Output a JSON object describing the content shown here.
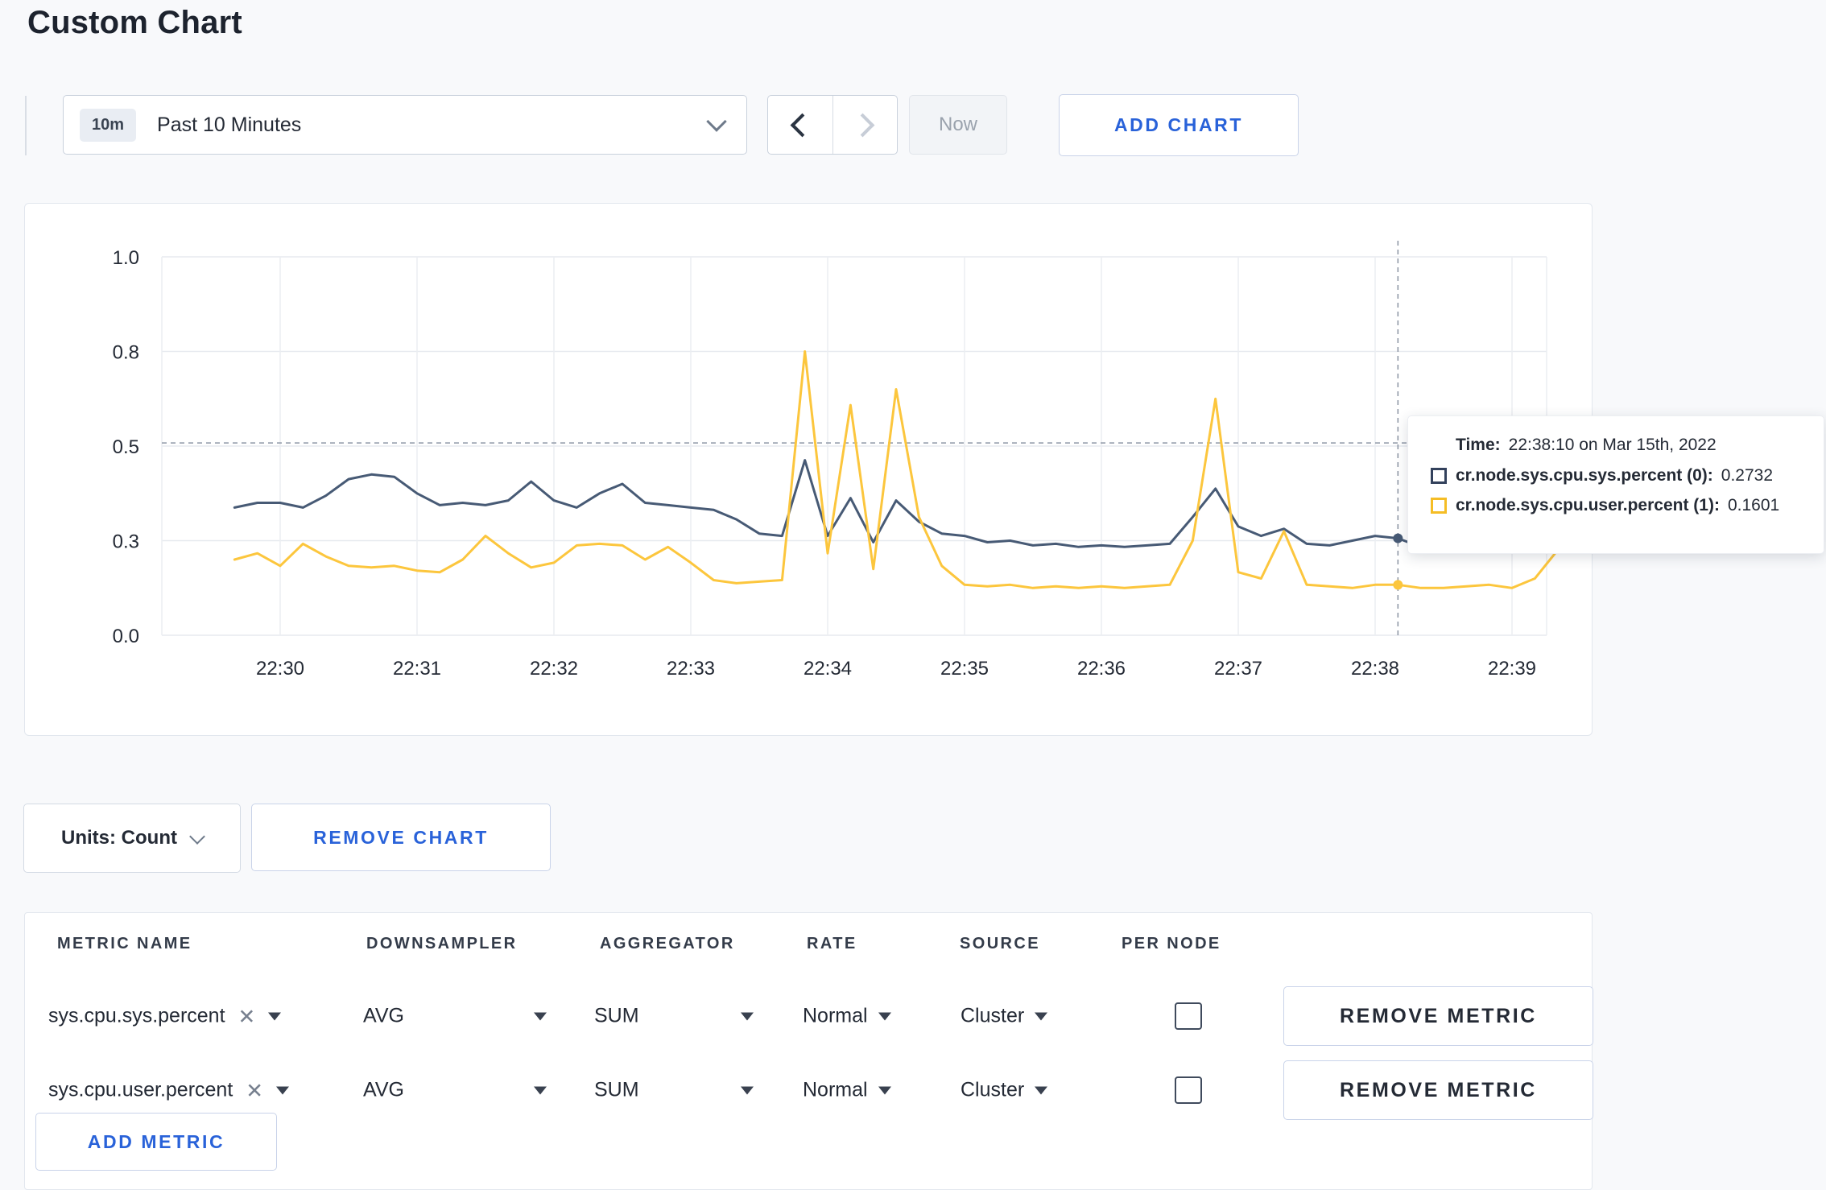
{
  "page": {
    "title": "Custom Chart"
  },
  "toolbar": {
    "time_badge": "10m",
    "time_label": "Past 10 Minutes",
    "now_label": "Now",
    "add_chart_label": "ADD CHART"
  },
  "chart_data": {
    "type": "line",
    "title": "",
    "xlabel": "",
    "ylabel": "",
    "x_ticks": [
      "22:30",
      "22:31",
      "22:32",
      "22:33",
      "22:34",
      "22:35",
      "22:36",
      "22:37",
      "22:38",
      "22:39"
    ],
    "y_ticks": [
      "1.0",
      "0.8",
      "0.5",
      "0.3",
      "0.0"
    ],
    "grid": true,
    "legend_position": "tooltip",
    "x_start_minutes": -0.3333,
    "x_step_minutes": 0.16667,
    "series": [
      {
        "name": "cr.node.sys.cpu.sys.percent",
        "color": "#475a75",
        "values": [
          0.37,
          0.38,
          0.38,
          0.37,
          0.395,
          0.43,
          0.44,
          0.435,
          0.4,
          0.375,
          0.38,
          0.375,
          0.385,
          0.425,
          0.385,
          0.37,
          0.4,
          0.42,
          0.38,
          0.375,
          0.37,
          0.365,
          0.345,
          0.315,
          0.31,
          0.47,
          0.31,
          0.39,
          0.295,
          0.385,
          0.34,
          0.315,
          0.31,
          0.295,
          0.3,
          0.285,
          0.29,
          0.28,
          0.285,
          0.28,
          0.285,
          0.29,
          0.35,
          0.41,
          0.33,
          0.31,
          0.325,
          0.29,
          0.285,
          0.3,
          0.31,
          0.305,
          0.28,
          0.27,
          0.29,
          0.3,
          0.3,
          0.295,
          0.3
        ]
      },
      {
        "name": "cr.node.sys.cpu.user.percent",
        "color": "#fcc63d",
        "values": [
          0.24,
          0.26,
          0.22,
          0.29,
          0.25,
          0.22,
          0.215,
          0.22,
          0.205,
          0.2,
          0.24,
          0.31,
          0.26,
          0.215,
          0.23,
          0.285,
          0.29,
          0.285,
          0.24,
          0.28,
          0.23,
          0.175,
          0.165,
          0.17,
          0.175,
          0.8,
          0.26,
          0.63,
          0.21,
          0.68,
          0.35,
          0.22,
          0.16,
          0.155,
          0.16,
          0.15,
          0.155,
          0.15,
          0.155,
          0.15,
          0.155,
          0.16,
          0.3,
          0.65,
          0.2,
          0.18,
          0.32,
          0.16,
          0.155,
          0.15,
          0.16,
          0.16,
          0.15,
          0.15,
          0.155,
          0.16,
          0.15,
          0.18,
          0.27
        ]
      }
    ],
    "crosshair": {
      "x_minutes": 8.1667,
      "hline_value": 0.51
    },
    "tooltip": {
      "time_label": "Time:",
      "time_value": "22:38:10 on Mar 15th, 2022",
      "rows": [
        {
          "name": "cr.node.sys.cpu.sys.percent (0):",
          "value": "0.2732",
          "color": "#33415c"
        },
        {
          "name": "cr.node.sys.cpu.user.percent (1):",
          "value": "0.1601",
          "color": "#f5bd25"
        }
      ]
    }
  },
  "controls": {
    "units_label": "Units: Count",
    "remove_chart_label": "REMOVE CHART",
    "add_metric_label": "ADD METRIC"
  },
  "metrics_table": {
    "headers": [
      "METRIC NAME",
      "DOWNSAMPLER",
      "AGGREGATOR",
      "RATE",
      "SOURCE",
      "PER NODE"
    ],
    "rows": [
      {
        "metric": "sys.cpu.sys.percent",
        "downsampler": "AVG",
        "aggregator": "SUM",
        "rate": "Normal",
        "source": "Cluster",
        "per_node_checked": false,
        "remove_label": "REMOVE METRIC"
      },
      {
        "metric": "sys.cpu.user.percent",
        "downsampler": "AVG",
        "aggregator": "SUM",
        "rate": "Normal",
        "source": "Cluster",
        "per_node_checked": false,
        "remove_label": "REMOVE METRIC"
      }
    ]
  }
}
